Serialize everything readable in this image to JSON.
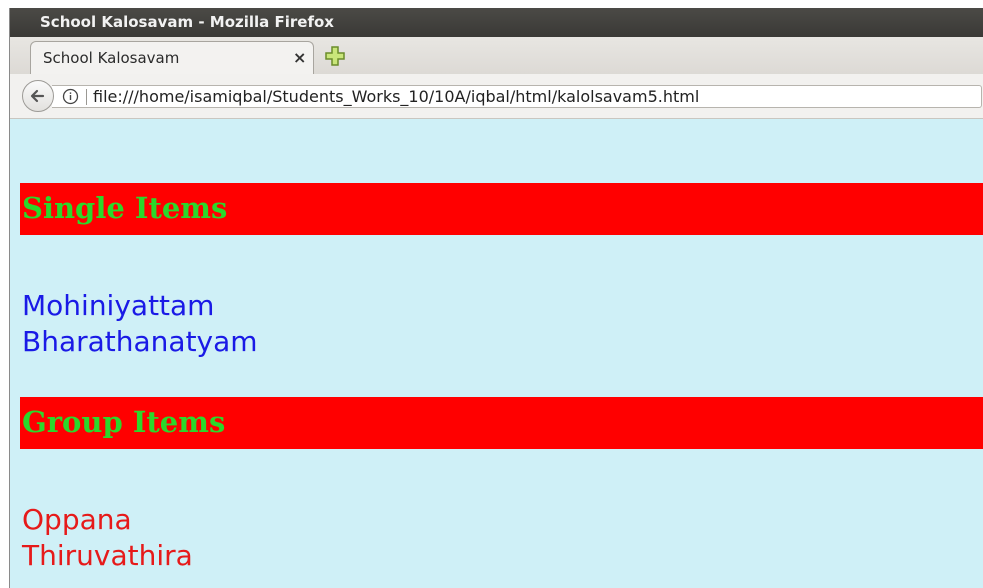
{
  "window": {
    "title": "School Kalosavam - Mozilla Firefox"
  },
  "tabs": [
    {
      "label": "School Kalosavam",
      "close_glyph": "×"
    }
  ],
  "toolbar": {
    "url": "file:///home/isamiqbal/Students_Works_10/10A/iqbal/html/kalolsavam5.html",
    "icons": [
      "back-arrow-icon",
      "info-icon",
      "new-tab-plus-icon"
    ]
  },
  "page": {
    "sections": [
      {
        "heading": "Single Items",
        "items": [
          "Mohiniyattam",
          "Bharathanatyam"
        ],
        "item_color": "#1a1ae6"
      },
      {
        "heading": "Group Items",
        "items": [
          "Oppana",
          "Thiruvathira"
        ],
        "item_color": "#e61a1a"
      }
    ],
    "colors": {
      "background": "#cff0f7",
      "heading_bg": "#ff0000",
      "heading_text": "#2bd82b"
    }
  }
}
